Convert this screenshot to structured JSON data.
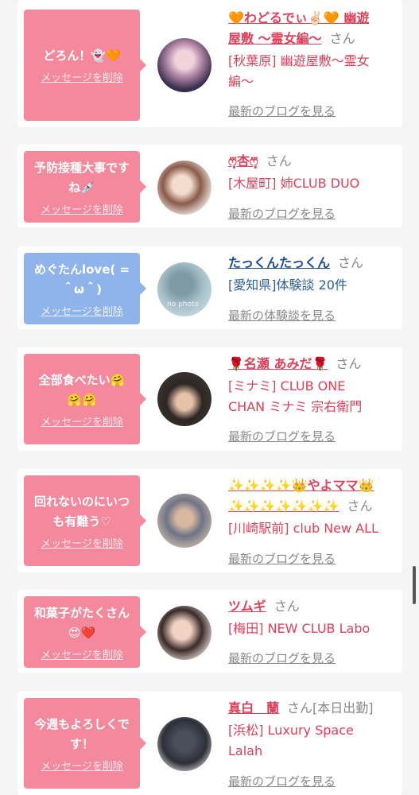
{
  "cards": [
    {
      "message": "どろん！👻🧡",
      "delete_label": "メッセージを削除",
      "name_main": "🧡わどるでぃ✌🏻🧡 幽遊屋敷 〜霊女編〜",
      "name_line1": "🧡わどるでぃ✌🏻🧡 幽遊",
      "name_line2": "屋敷 〜霊女編〜",
      "honorific": "さん",
      "shop_line1": "[秋葉原] 幽遊屋敷〜霊女",
      "shop_line2": "編〜",
      "link": "最新のブログを見る",
      "bubble_color": "pink"
    },
    {
      "message_line1": "予防接種大事です",
      "message_line2": "ね💉",
      "delete_label": "メッセージを削除",
      "name_main": "ෆ͙⃛杏ෆ͙⃛",
      "honorific": "さん",
      "shop_line1": "[木屋町] 姉CLUB DUO",
      "link": "最新のブログを見る",
      "bubble_color": "pink"
    },
    {
      "message_line1": "めぐたんlove( =",
      "message_line2": "＾ω＾)",
      "delete_label": "メッセージを削除",
      "name_main": "たっくんたっくん",
      "honorific": "さん",
      "shop_line1": "[愛知県]体験談 20件",
      "link": "最新の体験談を見る",
      "avatar_text": "no photo",
      "bubble_color": "blue"
    },
    {
      "message_line1": "全部食べたい🤗",
      "message_line2": "🤗🤗",
      "delete_label": "メッセージを削除",
      "name_main": "🌹名瀬 あみだ🌹",
      "honorific": "さん",
      "shop_line1": "[ミナミ] CLUB ONE",
      "shop_line2": "CHAN ミナミ 宗右衛門",
      "link": "最新のブログを見る",
      "bubble_color": "pink"
    },
    {
      "message_line1": "回れないのにいつ",
      "message_line2": "も有難う♡",
      "delete_label": "メッセージを削除",
      "name_line1": "✨✨✨✨👑やよママ👑",
      "name_line2": "✨✨✨✨✨✨✨",
      "honorific": "さん",
      "shop_line1": "[川崎駅前] club New ALL",
      "link": "最新のブログを見る",
      "bubble_color": "pink"
    },
    {
      "message_line1": "和菓子がたくさん",
      "message_line2": "😍❤️",
      "delete_label": "メッセージを削除",
      "name_main": "ツムギ",
      "honorific": "さん",
      "shop_line1": "[梅田] NEW CLUB Labo",
      "link": "最新のブログを見る",
      "bubble_color": "pink"
    },
    {
      "message_line1": "今週もよろしくで",
      "message_line2": "す！",
      "delete_label": "メッセージを削除",
      "name_main": "真白　蘭",
      "honorific": "さん[本日出勤]",
      "shop_line1": "[浜松] Luxury Space",
      "shop_line2": "Lalah",
      "link": "最新のブログを見る",
      "bubble_color": "pink"
    }
  ]
}
